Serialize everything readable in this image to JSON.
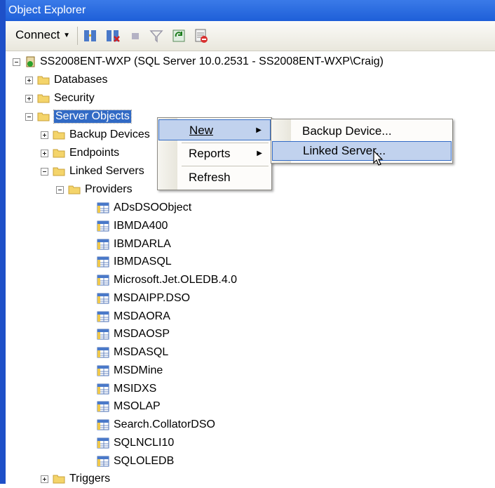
{
  "window": {
    "title": "Object Explorer"
  },
  "toolbar": {
    "connect_label": "Connect"
  },
  "tree": {
    "server": "SS2008ENT-WXP (SQL Server 10.0.2531 - SS2008ENT-WXP\\Craig)",
    "databases": "Databases",
    "security": "Security",
    "server_objects": "Server Objects",
    "backup_devices": "Backup Devices",
    "endpoints": "Endpoints",
    "linked_servers": "Linked Servers",
    "providers": "Providers",
    "provider_items": [
      "ADsDSOObject",
      "IBMDA400",
      "IBMDARLA",
      "IBMDASQL",
      "Microsoft.Jet.OLEDB.4.0",
      "MSDAIPP.DSO",
      "MSDAORA",
      "MSDAOSP",
      "MSDASQL",
      "MSDMine",
      "MSIDXS",
      "MSOLAP",
      "Search.CollatorDSO",
      "SQLNCLI10",
      "SQLOLEDB"
    ],
    "triggers": "Triggers"
  },
  "context_menu": {
    "new": "New",
    "reports": "Reports",
    "refresh": "Refresh"
  },
  "submenu": {
    "backup_device": "Backup Device...",
    "linked_server": "Linked Server..."
  }
}
